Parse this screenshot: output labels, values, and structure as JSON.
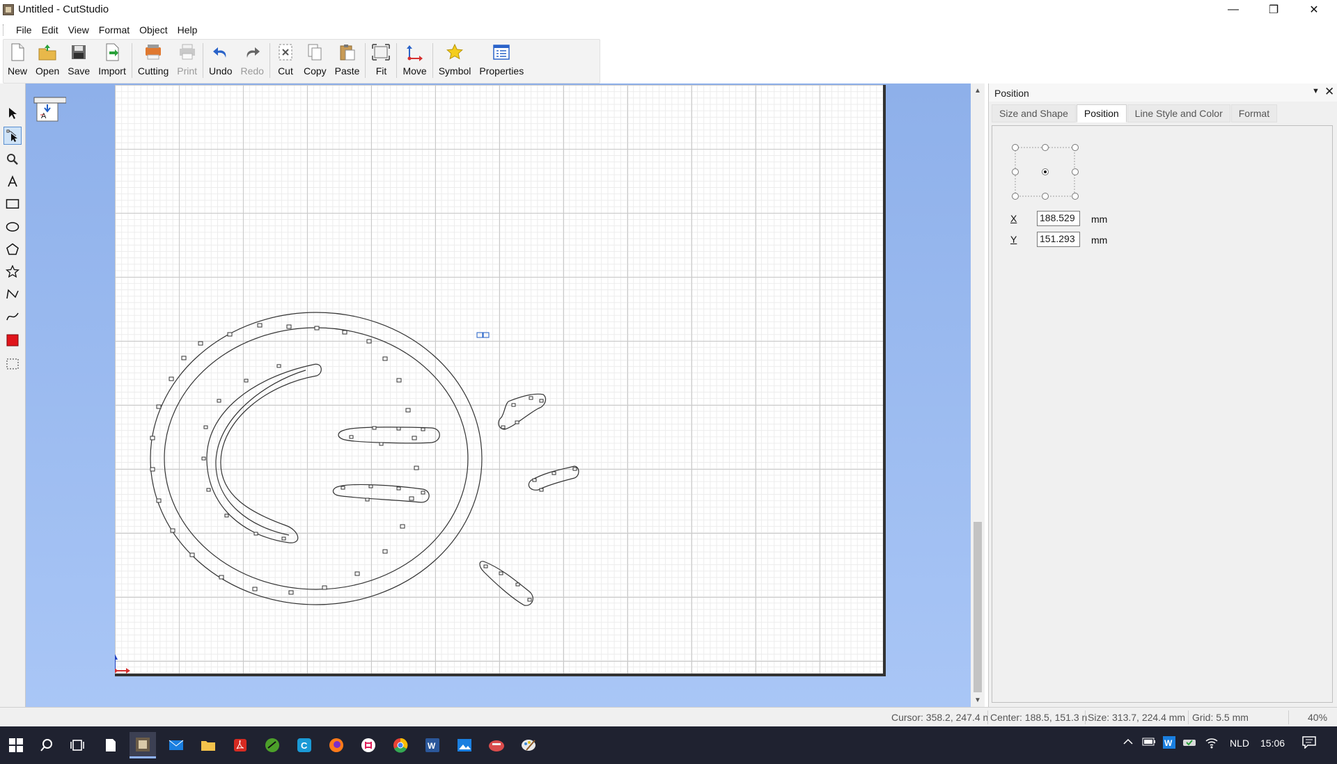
{
  "window": {
    "title": "Untitled - CutStudio",
    "minimize_glyph": "—",
    "maximize_glyph": "❐",
    "close_glyph": "✕"
  },
  "menu": [
    "File",
    "Edit",
    "View",
    "Format",
    "Object",
    "Help"
  ],
  "toolbar": [
    {
      "label": "New",
      "icon": "new-document-icon",
      "enabled": true
    },
    {
      "label": "Open",
      "icon": "open-folder-icon",
      "enabled": true
    },
    {
      "label": "Save",
      "icon": "save-floppy-icon",
      "enabled": true
    },
    {
      "label": "Import",
      "icon": "import-icon",
      "enabled": true
    },
    {
      "label": "Cutting",
      "icon": "cutting-icon",
      "enabled": true
    },
    {
      "label": "Print",
      "icon": "print-icon",
      "enabled": false
    },
    {
      "label": "Undo",
      "icon": "undo-icon",
      "enabled": true
    },
    {
      "label": "Redo",
      "icon": "redo-icon",
      "enabled": false
    },
    {
      "label": "Cut",
      "icon": "cut-icon",
      "enabled": true
    },
    {
      "label": "Copy",
      "icon": "copy-icon",
      "enabled": true
    },
    {
      "label": "Paste",
      "icon": "paste-icon",
      "enabled": true
    },
    {
      "label": "Fit",
      "icon": "fit-icon",
      "enabled": true
    },
    {
      "label": "Move",
      "icon": "move-icon",
      "enabled": true
    },
    {
      "label": "Symbol",
      "icon": "star-symbol-icon",
      "enabled": true
    },
    {
      "label": "Properties",
      "icon": "properties-icon",
      "enabled": true
    }
  ],
  "tools": [
    {
      "name": "select-tool-icon",
      "active": false
    },
    {
      "name": "node-edit-tool-icon",
      "active": true
    },
    {
      "name": "zoom-tool-icon",
      "active": false
    },
    {
      "name": "text-tool-icon",
      "active": false
    },
    {
      "name": "rectangle-tool-icon",
      "active": false
    },
    {
      "name": "ellipse-tool-icon",
      "active": false
    },
    {
      "name": "polygon-tool-icon",
      "active": false
    },
    {
      "name": "star-tool-icon",
      "active": false
    },
    {
      "name": "polyline-tool-icon",
      "active": false
    },
    {
      "name": "curve-tool-icon",
      "active": false
    },
    {
      "name": "fill-color-tool-icon",
      "active": false
    },
    {
      "name": "marquee-tool-icon",
      "active": false
    }
  ],
  "panel": {
    "title": "Position",
    "tabs": [
      {
        "label": "Size and Shape",
        "active": false
      },
      {
        "label": "Position",
        "active": true
      },
      {
        "label": "Line Style and Color",
        "active": false
      },
      {
        "label": "Format",
        "active": false
      }
    ],
    "x_label": "X",
    "x_value": "188.529",
    "y_label": "Y",
    "y_value": "151.293",
    "unit": "mm",
    "anchor_selected": "center"
  },
  "status": {
    "cursor": "Cursor: 358.2, 247.4 n",
    "center": "Center: 188.5, 151.3 n",
    "size": "Size: 313.7, 224.4 mm",
    "grid": "Grid: 5.5 mm",
    "zoom": "40%"
  },
  "taskbar": {
    "apps": [
      "start-icon",
      "search-icon",
      "task-view-icon",
      "notepad-icon",
      "cutstudio-icon",
      "mail-icon",
      "file-explorer-icon",
      "acrobat-icon",
      "app-green-icon",
      "app-c-icon",
      "firefox-icon",
      "slack-icon",
      "chrome-icon",
      "word-icon",
      "photos-icon",
      "app-red-icon",
      "app-paint-icon"
    ],
    "language": "NLD",
    "time": "15:06"
  },
  "colors": {
    "workspace_top": "#8eb0ea",
    "workspace_bottom": "#a9c6f6",
    "taskbar": "#1f2230",
    "accent": "#2b5fbf"
  }
}
